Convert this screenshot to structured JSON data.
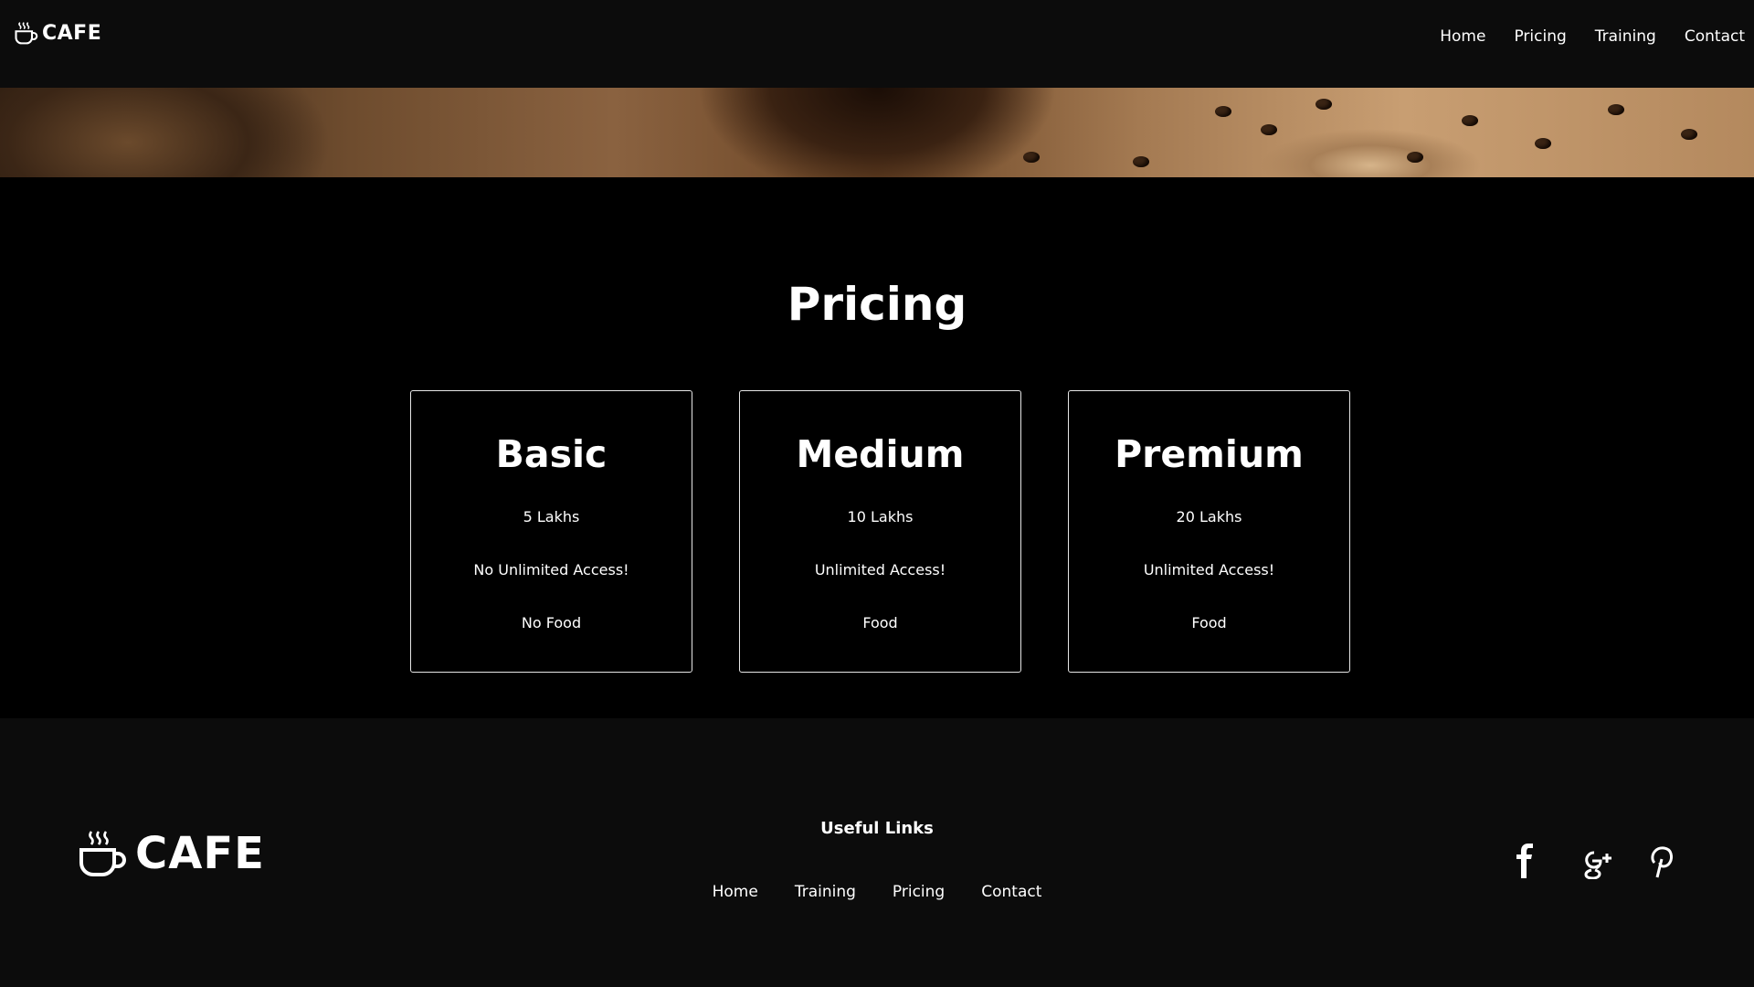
{
  "brand": {
    "name": "CAFE"
  },
  "nav": {
    "items": [
      {
        "label": "Home"
      },
      {
        "label": "Pricing"
      },
      {
        "label": "Training"
      },
      {
        "label": "Contact"
      }
    ]
  },
  "pricing": {
    "title": "Pricing",
    "plans": [
      {
        "name": "Basic",
        "price": "5 Lakhs",
        "access": "No Unlimited Access!",
        "food": "No Food"
      },
      {
        "name": "Medium",
        "price": "10 Lakhs",
        "access": "Unlimited Access!",
        "food": "Food"
      },
      {
        "name": "Premium",
        "price": "20 Lakhs",
        "access": "Unlimited Access!",
        "food": "Food"
      }
    ]
  },
  "footer": {
    "brand": "CAFE",
    "useful_links_title": "Useful Links",
    "links": [
      {
        "label": "Home"
      },
      {
        "label": "Training"
      },
      {
        "label": "Pricing"
      },
      {
        "label": "Contact"
      }
    ],
    "social": [
      {
        "icon": "facebook-icon"
      },
      {
        "icon": "google-plus-icon"
      },
      {
        "icon": "pinterest-icon"
      }
    ]
  },
  "colors": {
    "background": "#000000",
    "bar": "#0c0c0c",
    "text": "#ffffff",
    "card_border": "#e6e6e6"
  }
}
